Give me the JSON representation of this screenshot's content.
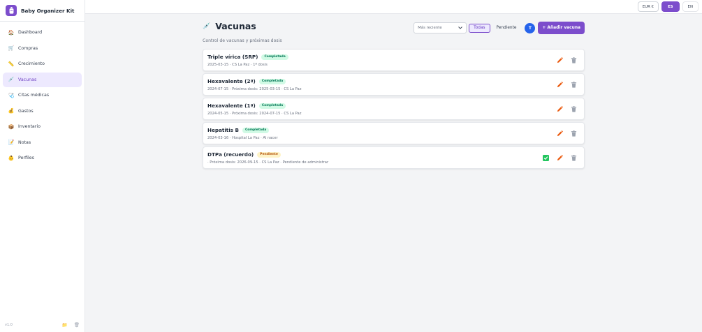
{
  "app": {
    "title": "Baby Organizer Kit",
    "version": "v1.0"
  },
  "sidebar": {
    "items": [
      {
        "label": "Dashboard",
        "icon": "house-icon"
      },
      {
        "label": "Compras",
        "icon": "cart-icon"
      },
      {
        "label": "Crecimiento",
        "icon": "ruler-icon"
      },
      {
        "label": "Vacunas",
        "icon": "syringe-icon",
        "active": true
      },
      {
        "label": "Citas médicas",
        "icon": "stethoscope-icon"
      },
      {
        "label": "Gastos",
        "icon": "money-bag-icon"
      },
      {
        "label": "Inventario",
        "icon": "box-icon"
      },
      {
        "label": "Notas",
        "icon": "memo-icon"
      },
      {
        "label": "Perfiles",
        "icon": "baby-icon"
      }
    ]
  },
  "topbar": {
    "currency": "EUR €",
    "lang_active": "ES",
    "lang_other": "EN"
  },
  "page": {
    "title": "Vacunas",
    "subtitle": "Control de vacunas y próximas dosis",
    "sort_value": "Más reciente",
    "filters": {
      "all": "Todas",
      "pending": "Pendiente"
    },
    "toggle_label": "T",
    "add_label": "+ Añadir vacuna"
  },
  "vaccines": [
    {
      "name": "Triple vírica (SRP)",
      "status": "Completada",
      "status_kind": "done",
      "meta": "2025-03-15 · CS La Paz · 1ª dosis"
    },
    {
      "name": "Hexavalente (2ª)",
      "status": "Completada",
      "status_kind": "done",
      "meta": "2024-07-15 · Próxima dosis: 2025-03-15 · CS La Paz"
    },
    {
      "name": "Hexavalente (1ª)",
      "status": "Completada",
      "status_kind": "done",
      "meta": "2024-05-15 · Próxima dosis: 2024-07-15 · CS La Paz"
    },
    {
      "name": "Hepatitis B",
      "status": "Completada",
      "status_kind": "done",
      "meta": "2024-03-16 · Hospital La Paz · Al nacer"
    },
    {
      "name": "DTPa (recuerdo)",
      "status": "Pendiente",
      "status_kind": "pending",
      "meta": "· Próxima dosis: 2026-09-15 · CS La Paz · Pendiente de administrar"
    }
  ],
  "colors": {
    "accent": "#7c4dcc",
    "accent_light": "#ede9fe",
    "edit": "#ea580c",
    "delete": "#9ca3af",
    "done_bg": "#d1fae5",
    "pending_bg": "#fef3c7"
  }
}
